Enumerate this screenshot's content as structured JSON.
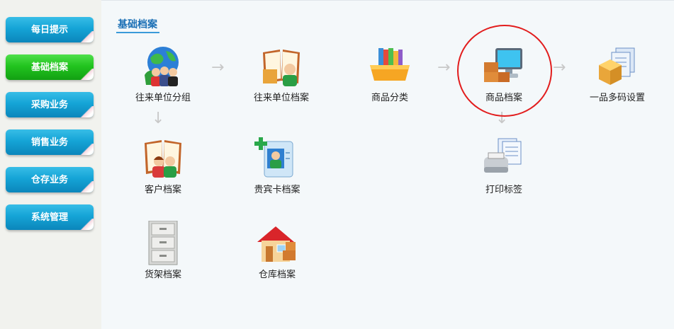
{
  "sidebar": {
    "items": [
      {
        "label": "每日提示",
        "active": false
      },
      {
        "label": "基础档案",
        "active": true
      },
      {
        "label": "采购业务",
        "active": false
      },
      {
        "label": "销售业务",
        "active": false
      },
      {
        "label": "仓存业务",
        "active": false
      },
      {
        "label": "系统管理",
        "active": false
      }
    ]
  },
  "main": {
    "title": "基础档案",
    "items": {
      "partner_group": {
        "label": "往来单位分组",
        "icon": "globe-people-icon"
      },
      "partner_file": {
        "label": "往来单位档案",
        "icon": "book-person-icon"
      },
      "goods_category": {
        "label": "商品分类",
        "icon": "book-tray-icon"
      },
      "goods_file": {
        "label": "商品档案",
        "icon": "boxes-monitor-icon"
      },
      "multi_barcode": {
        "label": "一品多码设置",
        "icon": "box-documents-icon"
      },
      "customer_file": {
        "label": "客户档案",
        "icon": "book-couple-icon"
      },
      "vip_card_file": {
        "label": "贵宾卡档案",
        "icon": "card-person-icon"
      },
      "print_label": {
        "label": "打印标签",
        "icon": "printer-icon"
      },
      "shelf_file": {
        "label": "货架档案",
        "icon": "cabinet-icon"
      },
      "warehouse_file": {
        "label": "仓库档案",
        "icon": "house-boxes-icon"
      }
    }
  },
  "colors": {
    "sidebar_button": "#15a4d6",
    "sidebar_active": "#22c41f",
    "title": "#1a6fb5",
    "highlight_circle": "#e21d1d"
  }
}
